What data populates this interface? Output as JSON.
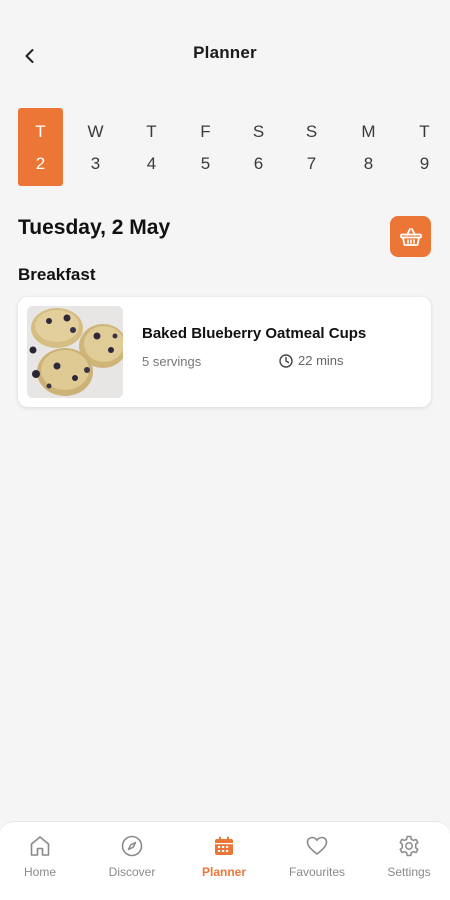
{
  "header": {
    "title": "Planner",
    "back_icon": "chevron-left-icon"
  },
  "week": {
    "days": [
      {
        "dow": "T",
        "num": "2",
        "active": true
      },
      {
        "dow": "W",
        "num": "3",
        "active": false
      },
      {
        "dow": "T",
        "num": "4",
        "active": false
      },
      {
        "dow": "F",
        "num": "5",
        "active": false
      },
      {
        "dow": "S",
        "num": "6",
        "active": false
      },
      {
        "dow": "S",
        "num": "7",
        "active": false
      },
      {
        "dow": "M",
        "num": "8",
        "active": false
      },
      {
        "dow": "T",
        "num": "9",
        "active": false
      }
    ]
  },
  "date_heading": "Tuesday, 2 May",
  "basket_icon": "shopping-basket-icon",
  "meal_section": {
    "heading": "Breakfast",
    "card": {
      "title": "Baked Blueberry Oatmeal Cups",
      "servings": "5 servings",
      "time": "22 mins",
      "time_icon": "clock-icon"
    }
  },
  "nav": {
    "items": [
      {
        "label": "Home",
        "icon": "home-icon",
        "active": false
      },
      {
        "label": "Discover",
        "icon": "compass-icon",
        "active": false
      },
      {
        "label": "Planner",
        "icon": "calendar-icon",
        "active": true
      },
      {
        "label": "Favourites",
        "icon": "heart-icon",
        "active": false
      },
      {
        "label": "Settings",
        "icon": "gear-icon",
        "active": false
      }
    ]
  },
  "colors": {
    "accent": "#ec7636",
    "background": "#f5f5f5",
    "card": "#ffffff",
    "muted_text": "#8a8a8a"
  }
}
